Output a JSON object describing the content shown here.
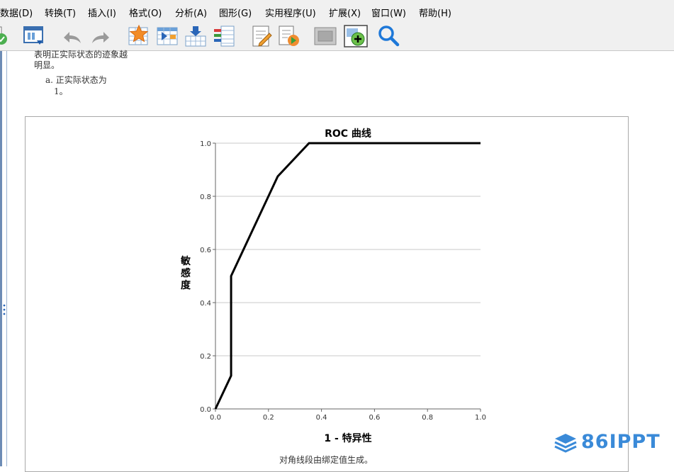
{
  "menubar": {
    "items": [
      {
        "label": "数据(D)"
      },
      {
        "label": "转换(T)"
      },
      {
        "label": "插入(I)"
      },
      {
        "label": "格式(O)"
      },
      {
        "label": "分析(A)"
      },
      {
        "label": "图形(G)"
      },
      {
        "label": "实用程序(U)"
      },
      {
        "label": "扩展(X)"
      },
      {
        "label": "窗口(W)"
      },
      {
        "label": "帮助(H)"
      }
    ]
  },
  "toolbar": {
    "icons": [
      "recall-dialog-icon",
      "export-icon",
      "undo-icon",
      "redo-icon",
      "goto-case-icon",
      "goto-variable-icon",
      "insert-variable-icon",
      "variables-list-icon",
      "edit-output-icon",
      "run-script-icon",
      "hide-icon",
      "insert-chart-icon",
      "find-icon"
    ]
  },
  "output": {
    "note_line1": "表明正实际状态的迹象越",
    "note_line2": "明显。",
    "footnote_a": "a. 正实际状态为",
    "footnote_a2": "1。",
    "chart_footnote": "对角线段由绑定值生成。"
  },
  "chart_data": {
    "type": "line",
    "title": "ROC 曲线",
    "xlabel": "1 - 特异性",
    "ylabel": "敏感度",
    "xlim": [
      0.0,
      1.0
    ],
    "ylim": [
      0.0,
      1.0
    ],
    "xticks": [
      "0.0",
      "0.2",
      "0.4",
      "0.6",
      "0.8",
      "1.0"
    ],
    "yticks": [
      "0.0",
      "0.2",
      "0.4",
      "0.6",
      "0.8",
      "1.0"
    ],
    "grid": "horizontal",
    "series": [
      {
        "x": [
          0.0,
          0.059,
          0.059,
          0.235,
          0.353,
          1.0
        ],
        "y": [
          0.0,
          0.125,
          0.5,
          0.875,
          1.0,
          1.0
        ]
      }
    ]
  },
  "watermark": {
    "text": "86IPPT",
    "color": "#3a8ad8"
  }
}
